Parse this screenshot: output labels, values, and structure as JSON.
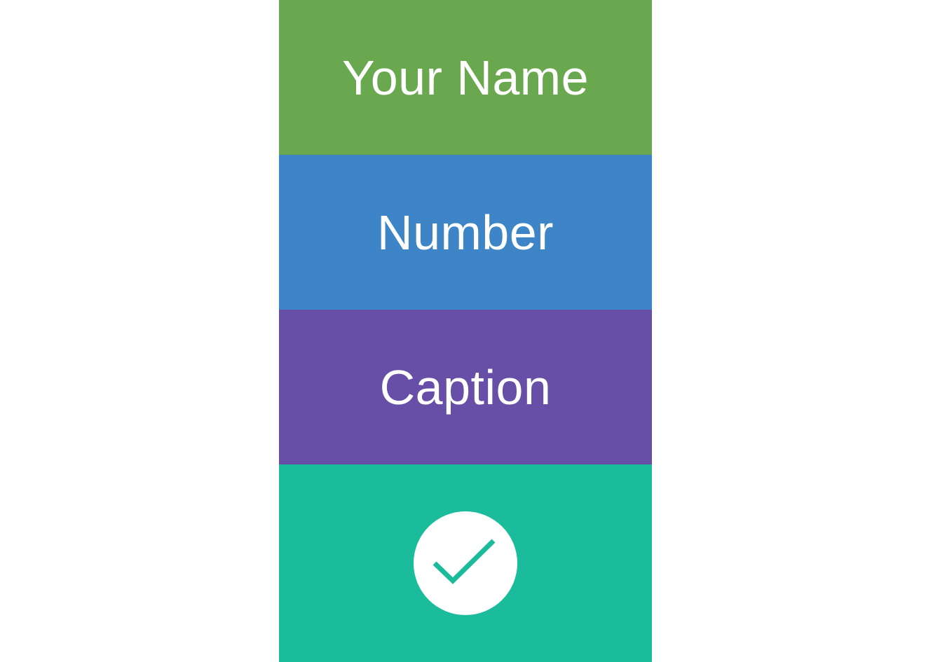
{
  "form": {
    "name_label": "Your Name",
    "number_label": "Number",
    "caption_label": "Caption"
  },
  "confirm": {
    "icon": "checkmark-icon"
  },
  "colors": {
    "name_bg": "#6aa84f",
    "number_bg": "#3d85c6",
    "caption_bg": "#674ea7",
    "confirm_bg": "#1abc9c",
    "text": "#ffffff"
  }
}
